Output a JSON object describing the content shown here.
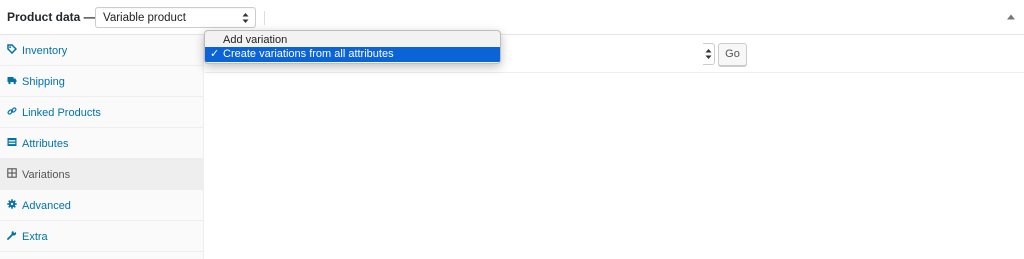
{
  "header": {
    "title": "Product data —",
    "product_type": "Variable product"
  },
  "sidebar": {
    "items": [
      {
        "label": "Inventory",
        "icon": "tag-icon"
      },
      {
        "label": "Shipping",
        "icon": "truck-icon"
      },
      {
        "label": "Linked Products",
        "icon": "link-icon"
      },
      {
        "label": "Attributes",
        "icon": "table-icon"
      },
      {
        "label": "Variations",
        "icon": "grid-icon",
        "active": true
      },
      {
        "label": "Advanced",
        "icon": "gear-icon"
      },
      {
        "label": "Extra",
        "icon": "wrench-icon"
      }
    ]
  },
  "variations": {
    "dropdown_options": [
      {
        "label": "Add variation",
        "selected": false
      },
      {
        "label": "Create variations from all attributes",
        "selected": true
      }
    ],
    "go_label": "Go"
  },
  "colors": {
    "link": "#0073aa",
    "active_tab_bg": "#eeeeee",
    "menu_highlight": "#0a64d8"
  }
}
